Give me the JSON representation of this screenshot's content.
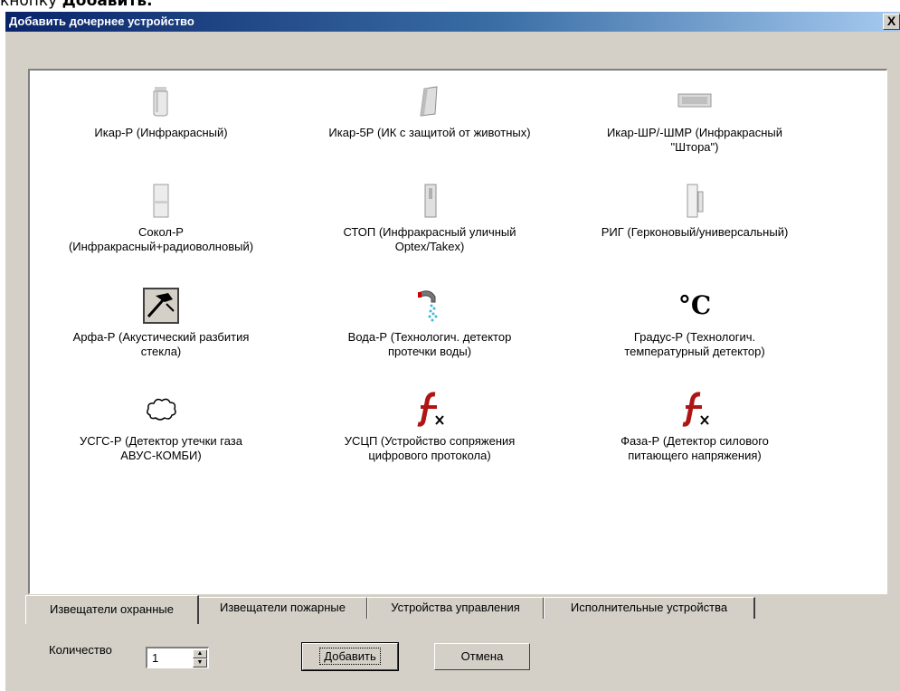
{
  "page_top_text": {
    "prefix": "кнопку ",
    "bold": "Добавить."
  },
  "window": {
    "title": "Добавить дочернее устройство",
    "close_glyph": "X"
  },
  "devices": [
    {
      "label": "Икар-Р (Инфракрасный)",
      "icon": "pir-sensor-icon"
    },
    {
      "label": "Икар-5Р (ИК с защитой от животных)",
      "icon": "pet-immune-sensor-icon"
    },
    {
      "label": "Икар-ШР/-ШМР (Инфракрасный\n\"Штора\")",
      "icon": "curtain-sensor-icon"
    },
    {
      "label": "Сокол-Р\n(Инфракрасный+радиоволновый)",
      "icon": "combo-sensor-icon"
    },
    {
      "label": "СТОП (Инфракрасный уличный\nOptex/Takex)",
      "icon": "outdoor-beam-sensor-icon"
    },
    {
      "label": "РИГ (Герконовый/универсальный)",
      "icon": "reed-switch-icon"
    },
    {
      "label": "Арфа-Р (Акустический разбития\nстекла)",
      "icon": "glass-break-hammer-icon"
    },
    {
      "label": "Вода-Р (Технологич. детектор\nпротечки воды)",
      "icon": "water-leak-icon"
    },
    {
      "label": "Градус-Р (Технологич.\nтемпературный детектор)",
      "icon": "temperature-icon",
      "glyph": "°C"
    },
    {
      "label": "УСГС-Р (Детектор утечки газа\nАВУС-КОМБИ)",
      "icon": "gas-cloud-icon"
    },
    {
      "label": "УСЦП (Устройство сопряжения\nцифрового протокола)",
      "icon": "function-icon"
    },
    {
      "label": "Фаза-Р (Детектор силового\nпитающего напряжения)",
      "icon": "function-icon"
    }
  ],
  "tabs": [
    {
      "label": "Извещатели охранные",
      "active": true
    },
    {
      "label": "Извещатели пожарные",
      "active": false
    },
    {
      "label": "Устройства управления",
      "active": false
    },
    {
      "label": "Исполнительные устройства",
      "active": false
    }
  ],
  "quantity": {
    "label": "Количество",
    "value": "1"
  },
  "buttons": {
    "add": "Добавить",
    "cancel": "Отмена"
  }
}
